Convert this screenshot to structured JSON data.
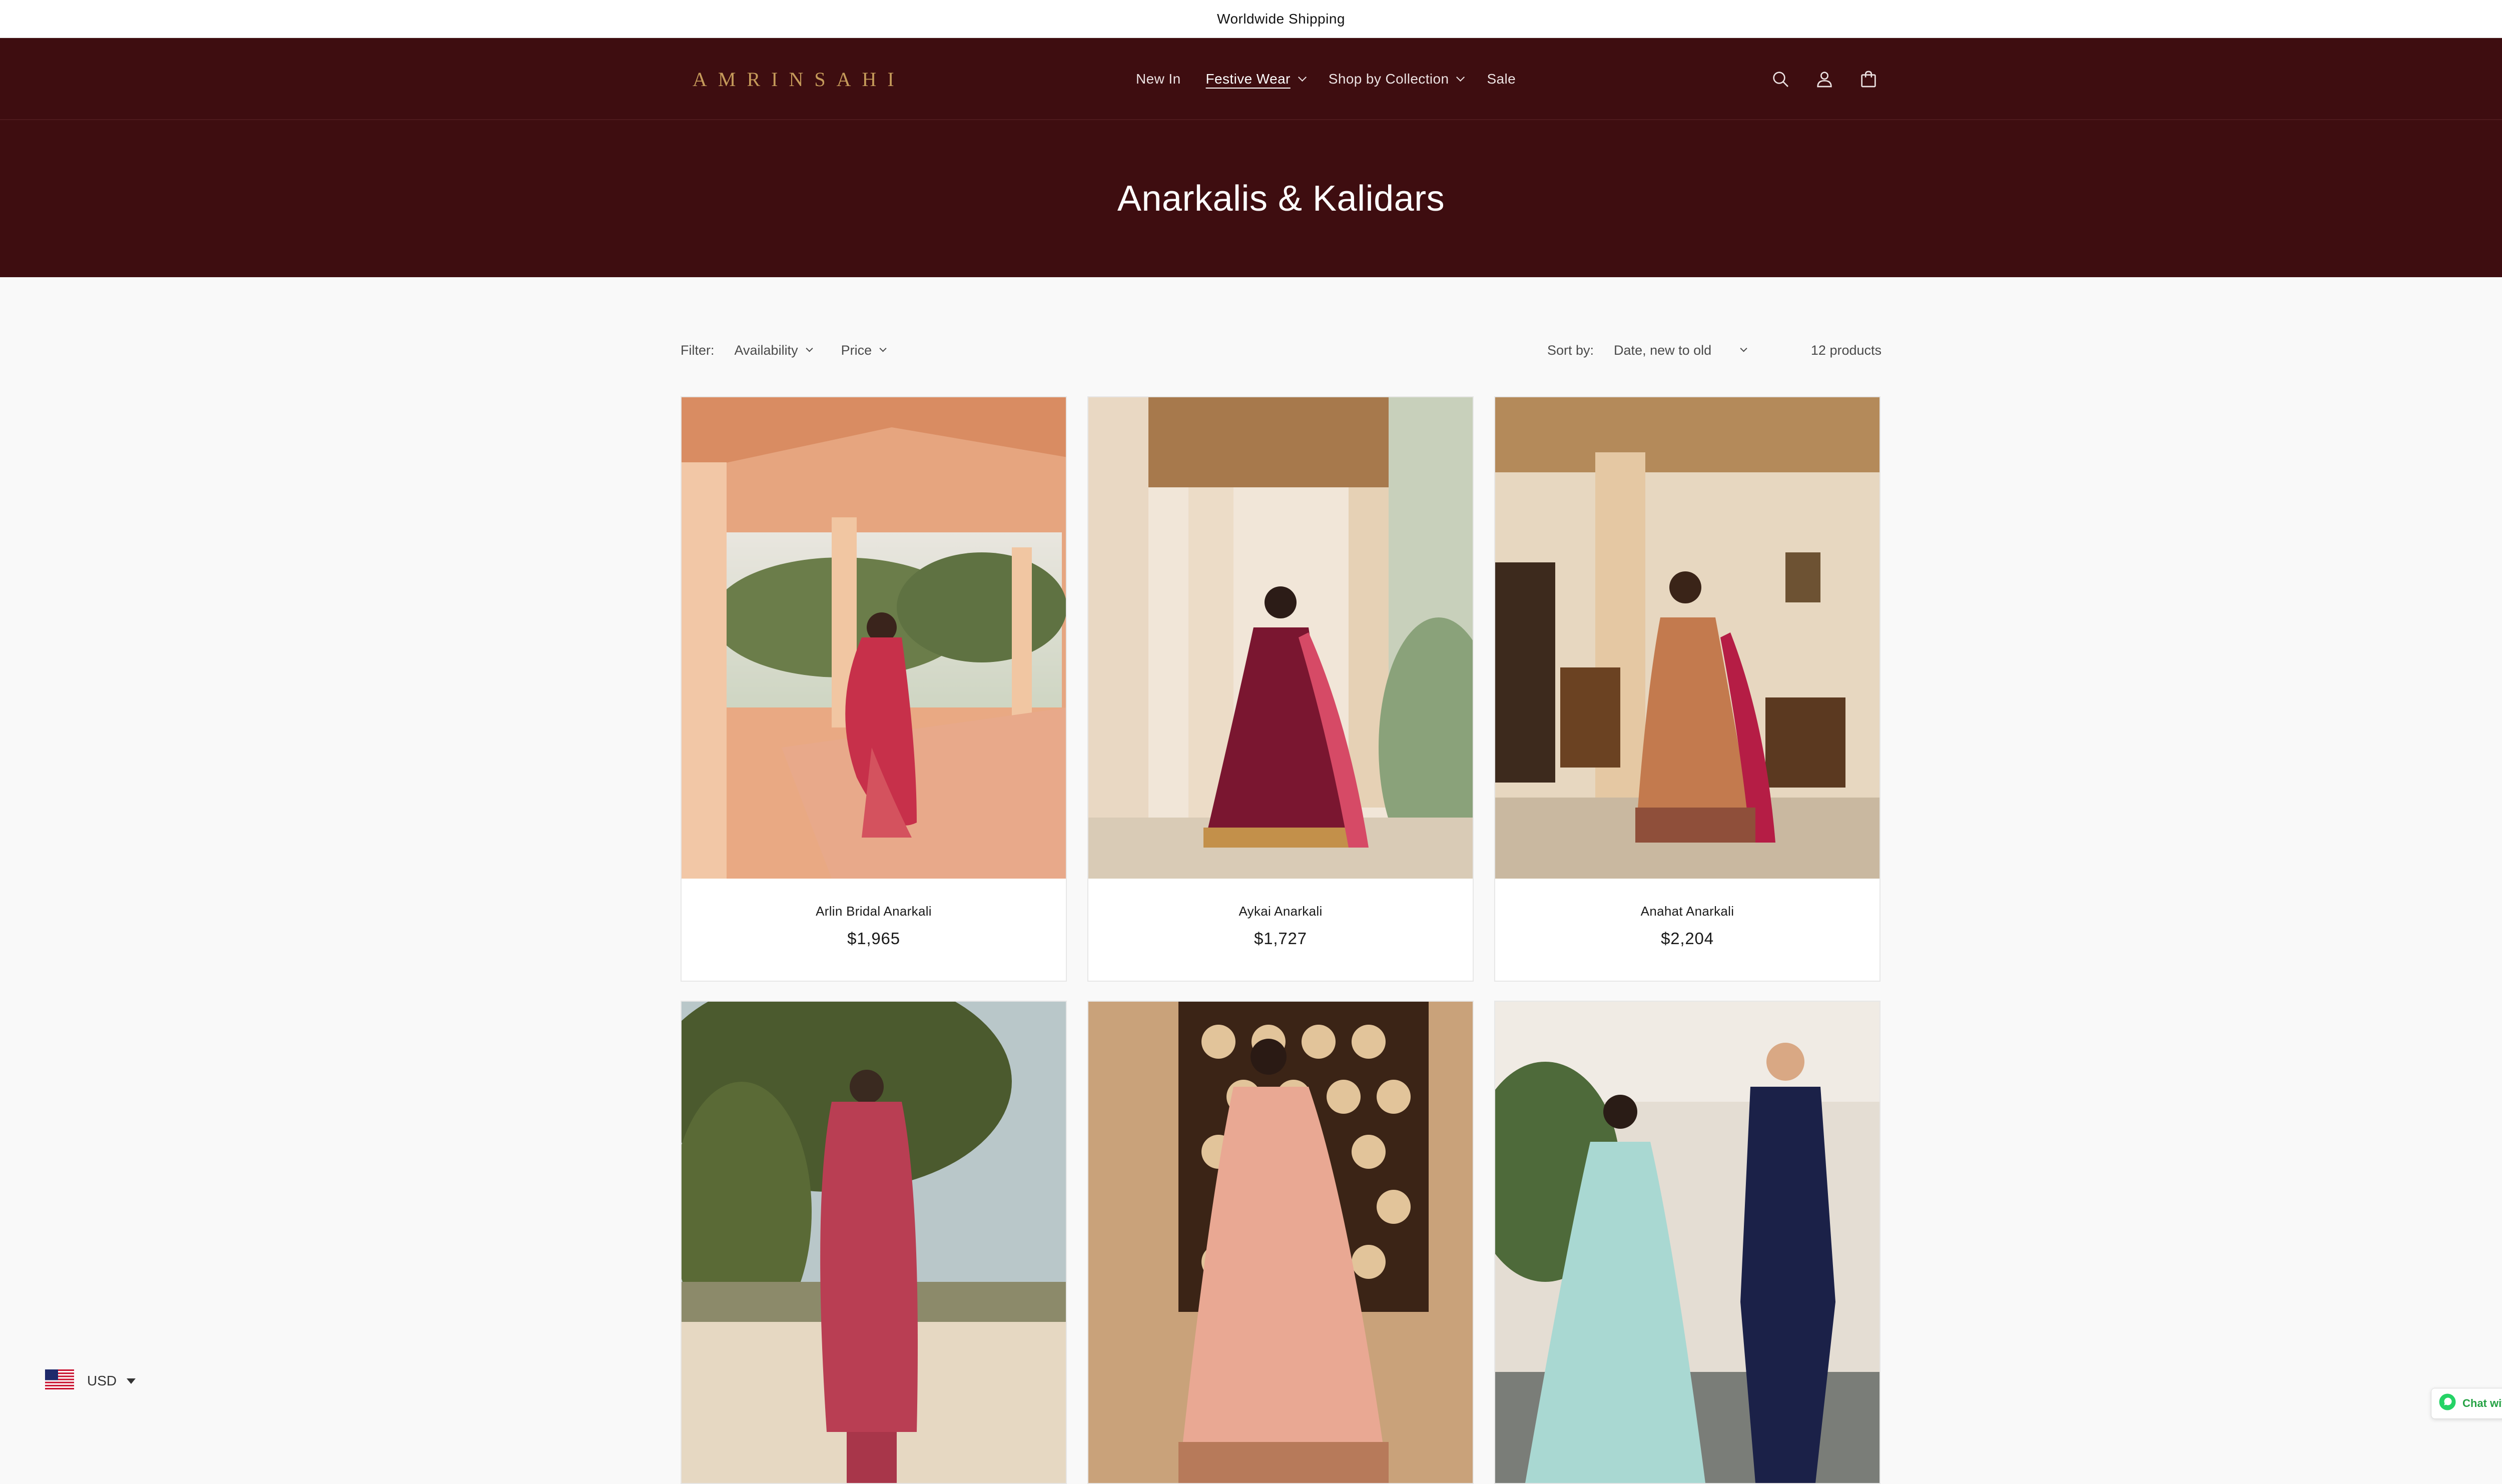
{
  "announcement": "Worldwide Shipping",
  "brand": {
    "logo_text": "AMRINSAHI",
    "header_color": "#3e0d10",
    "logo_color": "#c59a5a"
  },
  "nav": {
    "items": [
      {
        "label": "New In",
        "dropdown": false,
        "active": false
      },
      {
        "label": "Festive Wear",
        "dropdown": true,
        "active": true
      },
      {
        "label": "Shop by Collection",
        "dropdown": true,
        "active": false
      },
      {
        "label": "Sale",
        "dropdown": false,
        "active": false
      }
    ],
    "icons": [
      "search-icon",
      "account-icon",
      "cart-icon"
    ]
  },
  "collection": {
    "title": "Anarkalis & Kalidars"
  },
  "filters": {
    "label": "Filter:",
    "options": [
      "Availability",
      "Price"
    ],
    "sort_label": "Sort by:",
    "sort_value": "Date, new to old",
    "product_count": "12 products"
  },
  "products": [
    {
      "name": "Arlin Bridal Anarkali",
      "price": "$1,965"
    },
    {
      "name": "Aykai Anarkali",
      "price": "$1,727"
    },
    {
      "name": "Anahat Anarkali",
      "price": "$2,204"
    },
    {
      "name": "",
      "price": ""
    },
    {
      "name": "",
      "price": ""
    },
    {
      "name": "",
      "price": ""
    }
  ],
  "currency": {
    "code": "USD",
    "flag": "us-flag-icon"
  },
  "chat": {
    "label": "Chat with us"
  }
}
